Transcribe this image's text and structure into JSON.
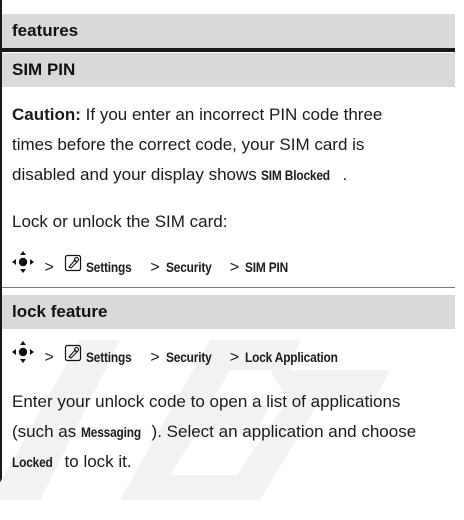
{
  "header": {
    "title": "features"
  },
  "sections": {
    "sim_pin": {
      "title": "SIM PIN",
      "caution_label": "Caution:",
      "caution_line1": " If you enter an incorrect PIN code three",
      "caution_line2": "times before the correct code, your SIM card is",
      "caution_line3": "disabled and your display shows ",
      "caution_term": "SIM Blocked",
      "caution_end": ".",
      "instruction": "Lock or unlock the SIM card:",
      "path": {
        "step1": "Settings",
        "step2": "Security",
        "step3": "SIM PIN"
      }
    },
    "lock_feature": {
      "title": "lock feature",
      "path": {
        "step1": "Settings",
        "step2": "Security",
        "step3": "Lock Application"
      },
      "line1": "Enter your unlock code to open a list of applications",
      "line2_start": "(such as ",
      "line2_term": "Messaging",
      "line2_end": "). Select an application and choose",
      "line3_term": "Locked",
      "line3_end": " to lock it."
    }
  },
  "separator": ">",
  "icons": {
    "nav_key": "nav-key-icon",
    "settings": "settings-icon"
  },
  "colors": {
    "header_bg": "#d9d9d9",
    "rule": "#1a1a1a",
    "watermark": "#f3f3f3"
  }
}
